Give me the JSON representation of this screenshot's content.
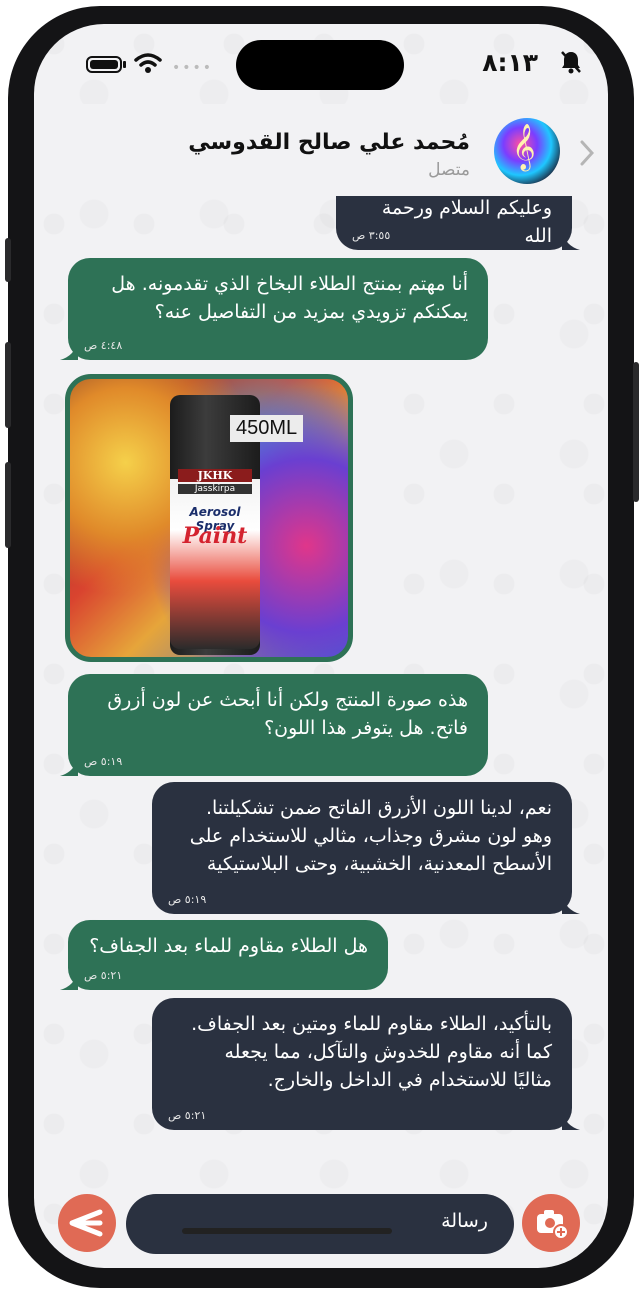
{
  "status_bar": {
    "time": "٨:١٣"
  },
  "header": {
    "contact_name": "مُحمد علي صالح القدوسي",
    "contact_status": "متصل"
  },
  "messages": [
    {
      "direction": "incoming",
      "text": "وعليكم السلام ورحمة الله",
      "time": "٣:٥٥ ص"
    },
    {
      "direction": "outgoing",
      "text": "أنا مهتم بمنتج الطلاء البخاخ الذي تقدمونه. هل\nيمكنكم تزويدي بمزيد من التفاصيل عنه؟",
      "time": "٤:٤٨ ص"
    },
    {
      "direction": "outgoing",
      "type": "image",
      "image_label": "450ML",
      "brand": "JKHK",
      "sub_brand": "Jasskirpa",
      "line1": "Aerosol Spray",
      "line2": "Paint"
    },
    {
      "direction": "outgoing",
      "text": "هذه صورة المنتج ولكن أنا أبحث عن لون أزرق\nفاتح. هل يتوفر هذا اللون؟",
      "time": "٥:١٩ ص"
    },
    {
      "direction": "incoming",
      "text": "نعم، لدينا اللون الأزرق الفاتح ضمن تشكيلتنا.\nوهو لون مشرق وجذاب، مثالي للاستخدام على\nالأسطح المعدنية، الخشبية، وحتى البلاستيكية",
      "time": "٥:١٩ ص"
    },
    {
      "direction": "outgoing",
      "text": "هل الطلاء مقاوم للماء بعد الجفاف؟",
      "time": "٥:٢١ ص"
    },
    {
      "direction": "incoming",
      "text": "بالتأكيد، الطلاء مقاوم للماء ومتين بعد الجفاف.\nكما أنه مقاوم للخدوش والتآكل، مما يجعله\nمثاليًا للاستخدام في الداخل والخارج.",
      "time": "٥:٢١ ص"
    }
  ],
  "composer": {
    "placeholder": "رسالة"
  },
  "colors": {
    "outgoing_bubble": "#2e7256",
    "incoming_bubble": "#2a3140",
    "accent": "#e06a55"
  }
}
